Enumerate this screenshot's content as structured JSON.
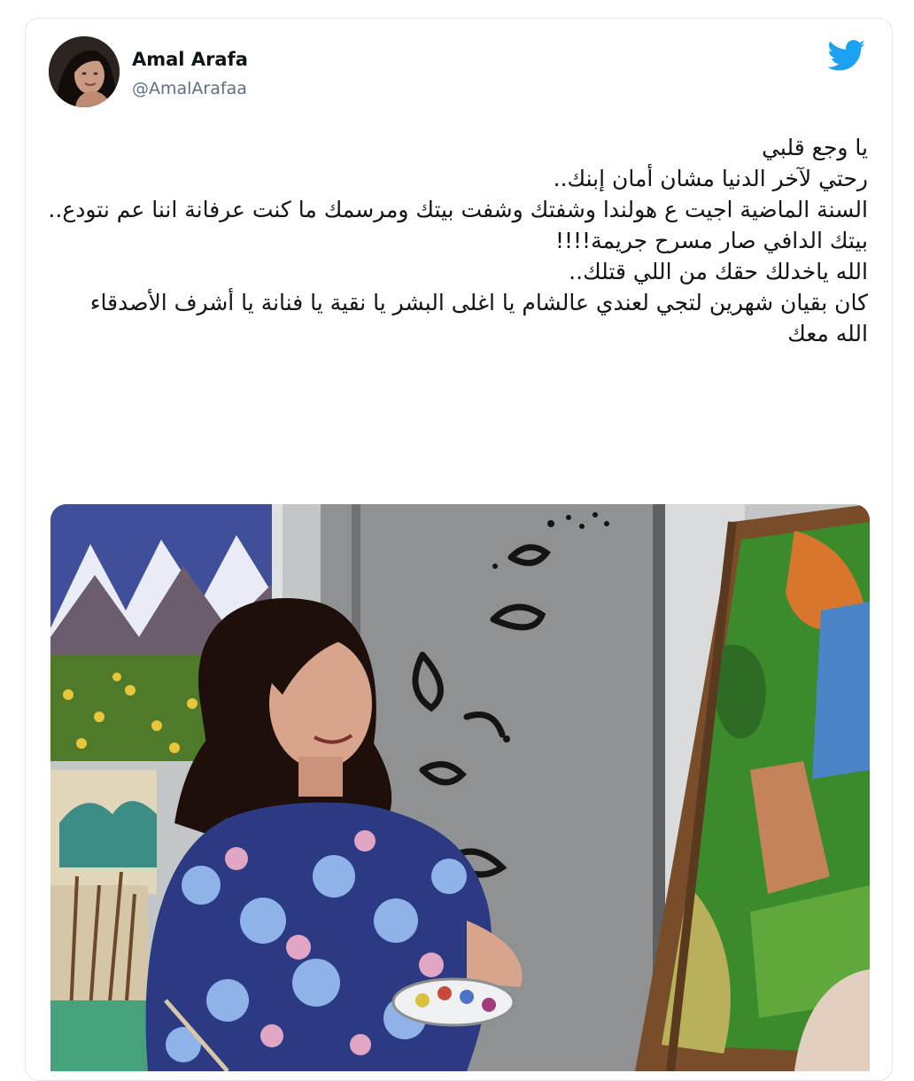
{
  "tweet": {
    "author_name": "Amal Arafa",
    "author_handle": "@AmalArafaa",
    "lines": [
      "يا وجع قلبي",
      "رحتي لآخر الدنيا مشان أمان إبنك..",
      "السنة الماضية اجيت ع هولندا وشفتك وشفت بيتك ومرسمك ما كنت عرفانة اننا عم نتودع..",
      "بيتك الدافي صار مسرح جريمة!!!!",
      "الله ياخدلك حقك من اللي قتلك..",
      "كان بقيان شهرين لتجي لعندي عالشام يا اغلى البشر يا نقية يا فنانة يا أشرف الأصدقاء",
      "الله معك"
    ]
  },
  "icons": {
    "brand": "twitter-bird-icon",
    "brand_color": "#1da1f2"
  }
}
